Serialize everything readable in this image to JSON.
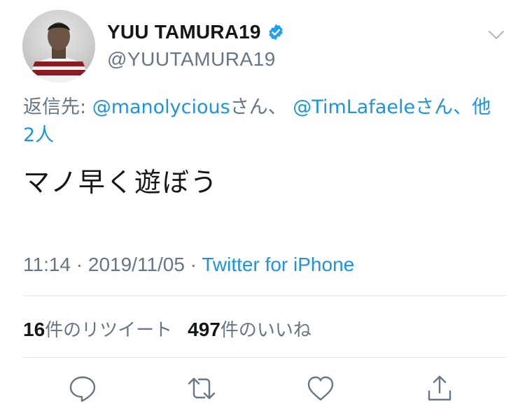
{
  "header": {
    "display_name": "YUU TAMURA19",
    "handle": "@YUUTAMURA19",
    "verified": true,
    "icons": {
      "verified": "verified-badge-icon",
      "menu": "chevron-down-icon"
    }
  },
  "reply": {
    "prefix": "返信先: ",
    "mention1": "@manolycious",
    "suffix1": "さん、",
    "mention2": "@TimLafaele",
    "suffix2": "さん、他",
    "others": "2人"
  },
  "tweet": {
    "text": "マノ早く遊ぼう"
  },
  "meta": {
    "time": "11:14",
    "sep1": " · ",
    "date": "2019/11/05",
    "sep2": " · ",
    "source": "Twitter for iPhone"
  },
  "stats": {
    "retweets_count": "16",
    "retweets_label": "件のリツイート",
    "likes_count": "497",
    "likes_label": "件のいいね"
  },
  "actions": [
    {
      "icon": "reply-icon"
    },
    {
      "icon": "retweet-icon"
    },
    {
      "icon": "like-icon"
    },
    {
      "icon": "share-icon"
    }
  ],
  "colors": {
    "text": "#14171a",
    "muted": "#657786",
    "link": "#1b95e0",
    "divider": "#e1e8ed"
  }
}
